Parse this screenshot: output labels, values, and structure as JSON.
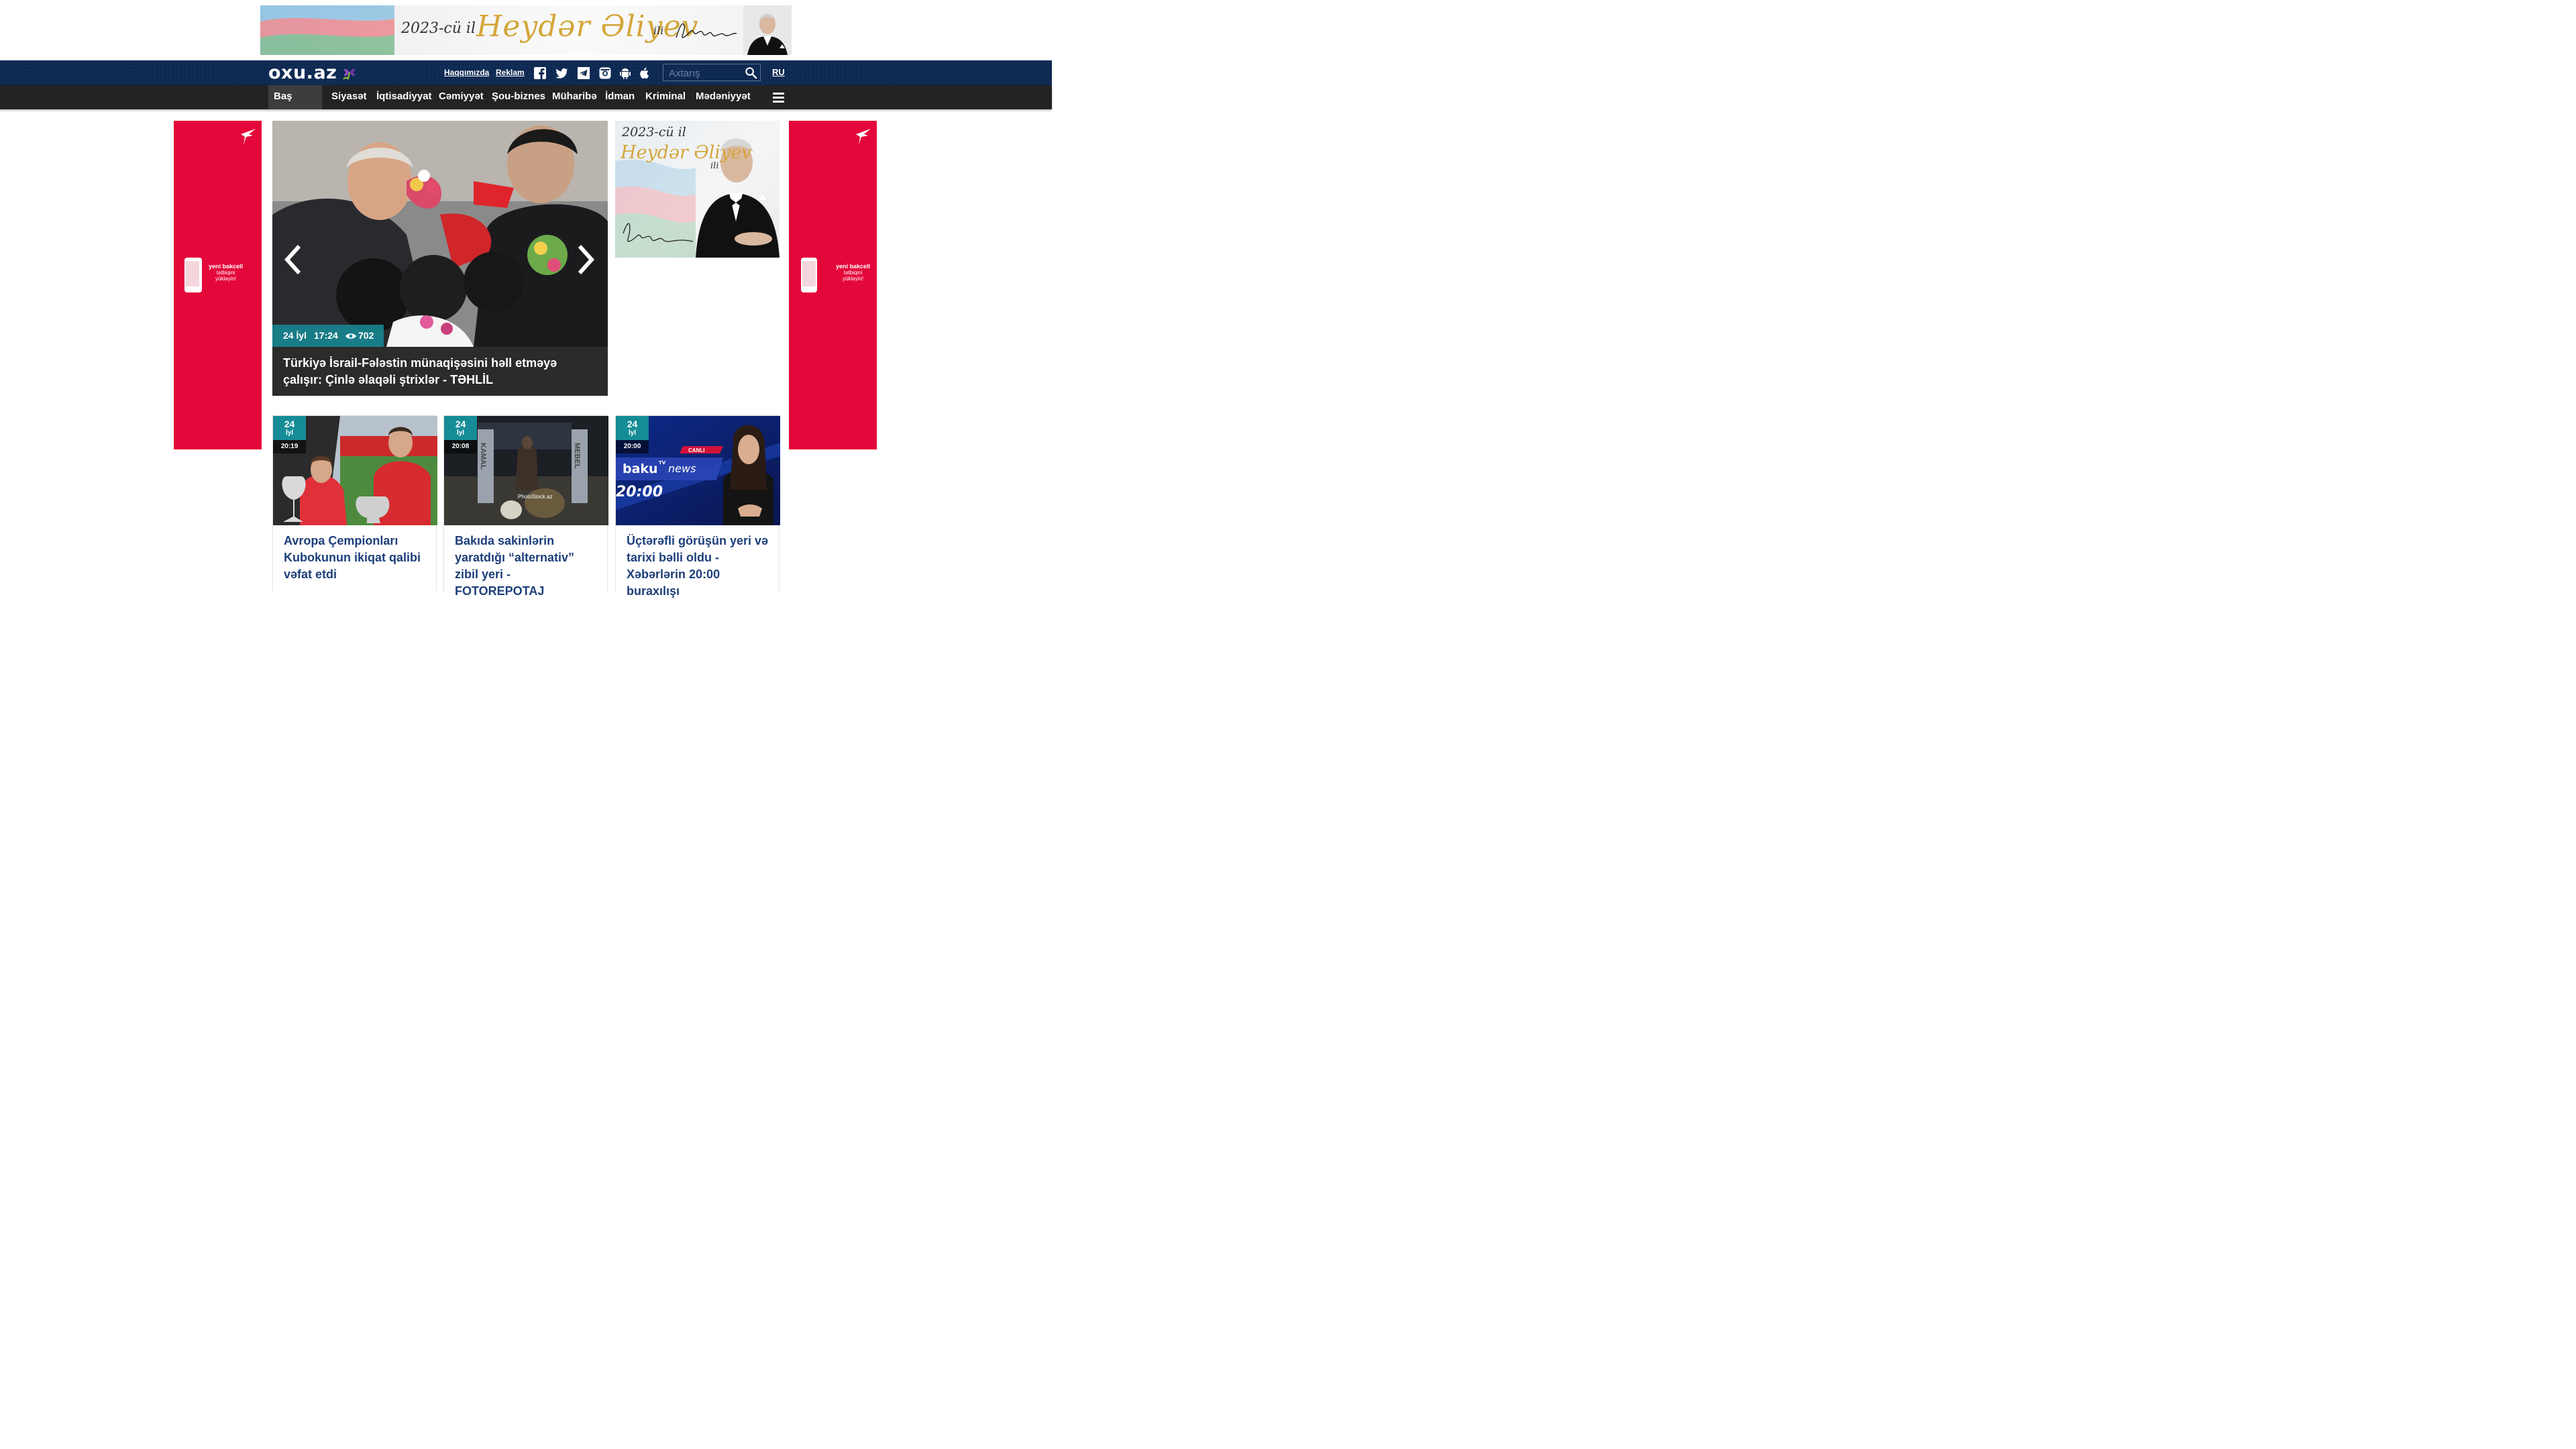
{
  "top_banner": {
    "year_text": "2023-cü il",
    "name_text": "Heydər Əliyev",
    "suffix_text": "ili"
  },
  "header": {
    "logo_text": "oxu.az",
    "links": [
      "Haqqımızda",
      "Reklam"
    ],
    "social_icons": [
      "facebook-icon",
      "twitter-icon",
      "telegram-icon",
      "instagram-icon",
      "android-icon",
      "apple-icon"
    ],
    "search_placeholder": "Axtarış",
    "lang": "RU",
    "bg_color": "#0e2a53"
  },
  "nav": {
    "items": [
      "Baş səhifə",
      "Siyasət",
      "İqtisadiyyat",
      "Cəmiyyət",
      "Şou-biznes",
      "Müharibə",
      "İdman",
      "Kriminal",
      "Mədəniyyət"
    ],
    "active_index": 0
  },
  "side_ads": {
    "line1": "yeni bakcell",
    "line2": "tətbiqini",
    "line3": "yükləyin!",
    "color": "#e4073a"
  },
  "right_ad": {
    "year_text": "2023-cü il",
    "name_text": "Heydər Əliyev",
    "suffix_text": "ili"
  },
  "hero": {
    "date": "24 İyl",
    "time": "17:24",
    "views": "702",
    "title": "Türkiyə İsrail-Fələstin münaqişəsini həll etməyə çalışır: Çinlə əlaqəli ştrixlər - TƏHLİL"
  },
  "cards": [
    {
      "day": "24",
      "month": "İyl",
      "time": "20:19",
      "title": "Avropa Çempionları Kubokunun ikiqat qalibi vəfat etdi"
    },
    {
      "day": "24",
      "month": "İyl",
      "time": "20:08",
      "title": "Bakıda sakinlərin yaratdığı “alternativ” zibil yeri - FOTOREPOTAJ"
    },
    {
      "day": "24",
      "month": "İyl",
      "time": "20:00",
      "title": "Üçtərəfli görüşün yeri və tarixi bəlli oldu - Xəbərlərin 20:00 buraxılışı"
    }
  ],
  "card_images": {
    "card3_brand": "baku",
    "card3_brand_sup": "TV",
    "card3_news": "news",
    "card3_time": "20:00",
    "card3_live": "CANLI",
    "card2_sign_left": "KAMAL",
    "card2_sign_right": "MEBEL",
    "card2_watermark": "PhotoStock.az"
  },
  "accent_color": "#168c96"
}
